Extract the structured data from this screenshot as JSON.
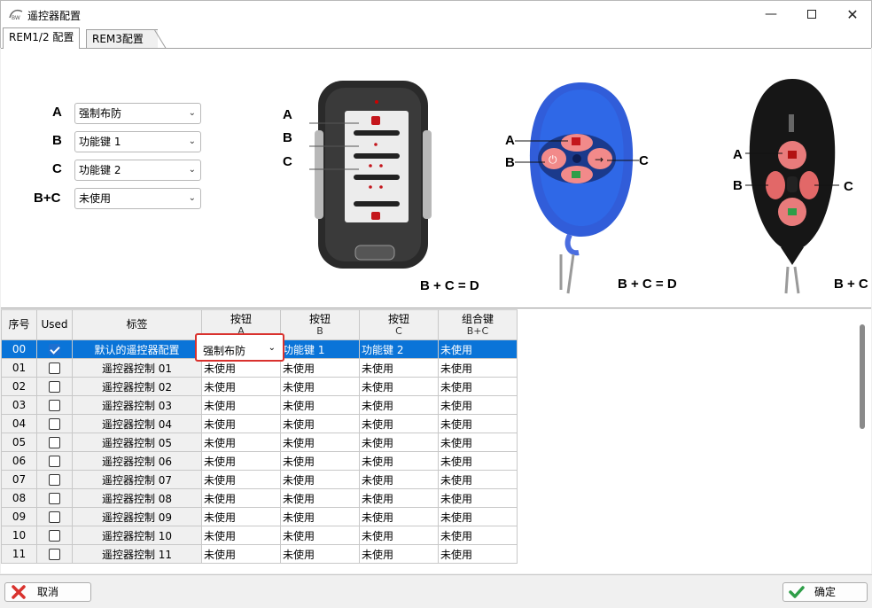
{
  "window": {
    "title": "遥控器配置",
    "minimize_icon": "minimize-icon",
    "maximize_icon": "maximize-icon",
    "close_icon": "close-icon"
  },
  "tabs": [
    {
      "label": "REM1/2 配置",
      "active": true
    },
    {
      "label": "REM3配置",
      "active": false
    }
  ],
  "config": {
    "rows": [
      {
        "key": "A",
        "value": "强制布防"
      },
      {
        "key": "B",
        "value": "功能键 1"
      },
      {
        "key": "C",
        "value": "功能键 2"
      },
      {
        "key": "B+C",
        "value": "未使用"
      }
    ]
  },
  "figures": {
    "rem1": {
      "labels": [
        "A",
        "B",
        "C"
      ],
      "formula": "B + C = D"
    },
    "rem2": {
      "labels": [
        "A",
        "B",
        "C"
      ],
      "formula": "B + C = D"
    },
    "rem3": {
      "labels": [
        "A",
        "B",
        "C"
      ],
      "formula": "B + C"
    }
  },
  "grid": {
    "headers": {
      "index": "序号",
      "used": "Used",
      "label": "标签",
      "btn_a": {
        "title": "按钮",
        "sub": "A"
      },
      "btn_b": {
        "title": "按钮",
        "sub": "B"
      },
      "btn_c": {
        "title": "按钮",
        "sub": "C"
      },
      "combo": {
        "title": "组合键",
        "sub": "B+C"
      }
    },
    "rows": [
      {
        "index": "00",
        "used": true,
        "label": "默认的遥控器配置",
        "a": "强制布防",
        "b": "功能键 1",
        "c": "功能键 2",
        "bc": "未使用",
        "selected": true
      },
      {
        "index": "01",
        "used": false,
        "label": "遥控器控制 01",
        "a": "未使用",
        "b": "未使用",
        "c": "未使用",
        "bc": "未使用"
      },
      {
        "index": "02",
        "used": false,
        "label": "遥控器控制 02",
        "a": "未使用",
        "b": "未使用",
        "c": "未使用",
        "bc": "未使用"
      },
      {
        "index": "03",
        "used": false,
        "label": "遥控器控制 03",
        "a": "未使用",
        "b": "未使用",
        "c": "未使用",
        "bc": "未使用"
      },
      {
        "index": "04",
        "used": false,
        "label": "遥控器控制 04",
        "a": "未使用",
        "b": "未使用",
        "c": "未使用",
        "bc": "未使用"
      },
      {
        "index": "05",
        "used": false,
        "label": "遥控器控制 05",
        "a": "未使用",
        "b": "未使用",
        "c": "未使用",
        "bc": "未使用"
      },
      {
        "index": "06",
        "used": false,
        "label": "遥控器控制 06",
        "a": "未使用",
        "b": "未使用",
        "c": "未使用",
        "bc": "未使用"
      },
      {
        "index": "07",
        "used": false,
        "label": "遥控器控制 07",
        "a": "未使用",
        "b": "未使用",
        "c": "未使用",
        "bc": "未使用"
      },
      {
        "index": "08",
        "used": false,
        "label": "遥控器控制 08",
        "a": "未使用",
        "b": "未使用",
        "c": "未使用",
        "bc": "未使用"
      },
      {
        "index": "09",
        "used": false,
        "label": "遥控器控制 09",
        "a": "未使用",
        "b": "未使用",
        "c": "未使用",
        "bc": "未使用"
      },
      {
        "index": "10",
        "used": false,
        "label": "遥控器控制 10",
        "a": "未使用",
        "b": "未使用",
        "c": "未使用",
        "bc": "未使用"
      },
      {
        "index": "11",
        "used": false,
        "label": "遥控器控制 11",
        "a": "未使用",
        "b": "未使用",
        "c": "未使用",
        "bc": "未使用"
      }
    ],
    "editing_cell": {
      "value": "强制布防"
    }
  },
  "buttons": {
    "cancel": {
      "label": "取消",
      "icon": "cancel-x-icon"
    },
    "ok": {
      "label": "确定",
      "icon": "checkmark-icon"
    }
  },
  "colors": {
    "selection": "#0a74d8",
    "highlight_border": "#d9322e",
    "cancel_icon": "#d9322e",
    "ok_icon": "#2e9e48"
  }
}
